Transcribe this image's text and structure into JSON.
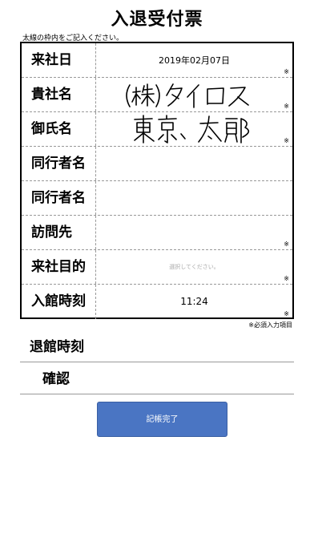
{
  "page": {
    "title": "入退受付票",
    "instruction": "太線の枠内をご記入ください。"
  },
  "form": {
    "rows": [
      {
        "label": "来社日",
        "value": "2019年02月07日",
        "required_mark": "※"
      },
      {
        "label": "貴社名",
        "handwritten": "(株)タイロス",
        "required_mark": "※"
      },
      {
        "label": "御氏名",
        "handwritten": "東京 太郎",
        "required_mark": "※"
      },
      {
        "label": "同行者名",
        "value": ""
      },
      {
        "label": "同行者名",
        "value": ""
      },
      {
        "label": "訪問先",
        "value": "",
        "required_mark": "※"
      },
      {
        "label": "来社目的",
        "placeholder": "選択してください。",
        "required_mark": "※"
      },
      {
        "label": "入館時刻",
        "value": "11:24",
        "required_mark": "※"
      }
    ],
    "required_note": "※必須入力項目"
  },
  "exit_time": {
    "label": "退館時刻"
  },
  "confirm": {
    "label": "確認"
  },
  "submit": {
    "label": "記帳完了",
    "color": "#4a75c3"
  }
}
